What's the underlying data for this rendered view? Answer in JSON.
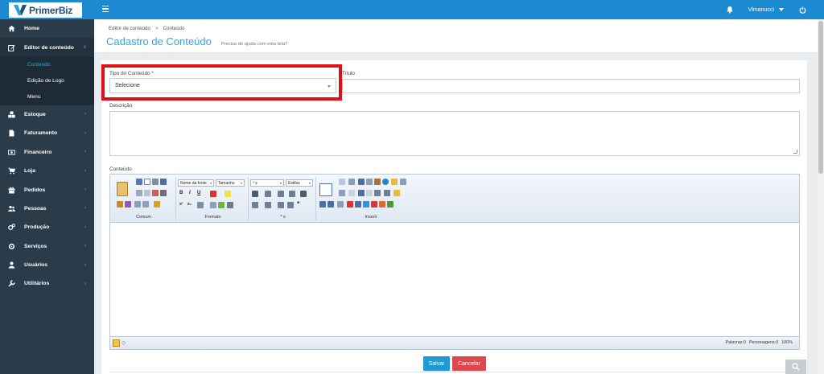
{
  "app": {
    "name": "PrimerBiz"
  },
  "topbar": {
    "user": "Vlmanucci"
  },
  "sidebar": {
    "items": [
      {
        "label": "Home",
        "icon": "home-icon",
        "arrow": ""
      },
      {
        "label": "Editor de conteúdo",
        "icon": "edit-icon",
        "arrow": "v"
      },
      {
        "label": "Estoque",
        "icon": "boxes-icon",
        "arrow": "›"
      },
      {
        "label": "Faturamento",
        "icon": "file-icon",
        "arrow": "›"
      },
      {
        "label": "Financeiro",
        "icon": "money-icon",
        "arrow": "›"
      },
      {
        "label": "Loja",
        "icon": "cart-icon",
        "arrow": "›"
      },
      {
        "label": "Pedidos",
        "icon": "gift-icon",
        "arrow": "›"
      },
      {
        "label": "Pessoas",
        "icon": "users-icon",
        "arrow": "›"
      },
      {
        "label": "Produção",
        "icon": "cogs-icon",
        "arrow": "›"
      },
      {
        "label": "Serviços",
        "icon": "gear-icon",
        "arrow": "›"
      },
      {
        "label": "Usuários",
        "icon": "user-icon",
        "arrow": "›"
      },
      {
        "label": "Utilitários",
        "icon": "wrench-icon",
        "arrow": "›"
      }
    ],
    "subitems": [
      {
        "label": "Conteúdo"
      },
      {
        "label": "Edição de Logo"
      },
      {
        "label": "Menu"
      }
    ]
  },
  "breadcrumb": {
    "parent": "Editor de conteúdo",
    "separator": ">",
    "current": "Conteúdo"
  },
  "page": {
    "title": "Cadastro de Conteúdo",
    "help": "Precisa de ajuda com esta tela?"
  },
  "form": {
    "tipo_label": "Tipo do Conteúdo *",
    "tipo_value": "Selecione",
    "titulo_label": "Título",
    "descricao_label": "Descrição",
    "conteudo_label": "Conteúdo"
  },
  "editor": {
    "groups": {
      "comum": "Comum",
      "formato": "Formato",
      "estilos_group": "* s",
      "inserir": "Inserir"
    },
    "font_name": "Nome da fonte",
    "font_size": "Tamanho",
    "paragraph": "º s",
    "styles": "Estilos",
    "status": {
      "words": "Palavras:0",
      "chars": "Personagens:0",
      "zoom": "100%"
    }
  },
  "buttons": {
    "save": "Salvar",
    "cancel": "Cancelar"
  },
  "colors": {
    "accent": "#1b8ad0",
    "sidebar": "#2a3b4a",
    "highlight": "#e01018",
    "danger": "#e0474a"
  }
}
